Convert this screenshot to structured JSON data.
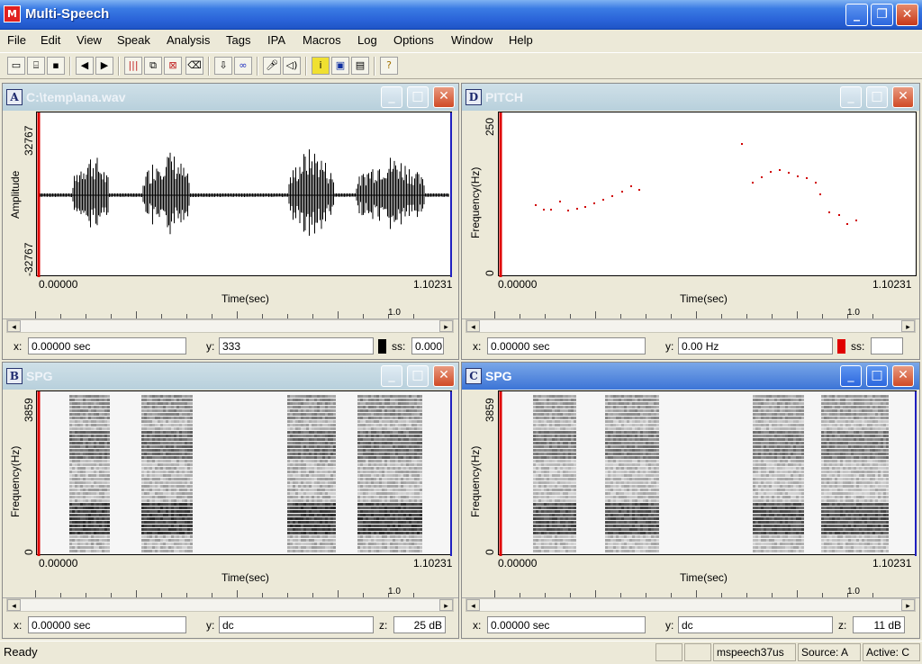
{
  "app": {
    "title": "Multi-Speech",
    "icon": "multi-speech-logo",
    "ready": "Ready"
  },
  "menu": [
    "File",
    "Edit",
    "View",
    "Speak",
    "Analysis",
    "Tags",
    "IPA",
    "Macros",
    "Log",
    "Options",
    "Window",
    "Help"
  ],
  "toolbar_icons": [
    "new-icon",
    "open-icon",
    "save-icon",
    "back-icon",
    "forward-icon",
    "bars-icon",
    "copy-window-icon",
    "delete-window-icon",
    "eraser-icon",
    "down-arrow-icon",
    "link-icon",
    "microphone-icon",
    "speaker-icon",
    "info-icon",
    "window-icon",
    "grid-icon",
    "help-icon"
  ],
  "panes": [
    {
      "letter": "A",
      "title": "C:\\temp\\ana.wav",
      "ylabel": "Amplitude",
      "ytop": "32767",
      "ybot": "-32767",
      "xstart": "0.00000",
      "xend": "1.10231",
      "xlabel": "Time(sec)",
      "ruler_mark": "1.0",
      "status": {
        "xlabel": "x:",
        "xval": "0.00000 sec",
        "ylabel": "y:",
        "yval": "333",
        "tag": "ss:",
        "tagval": "0.000"
      }
    },
    {
      "letter": "D",
      "title": "PITCH",
      "ylabel": "Frequency(Hz)",
      "ytop": "250",
      "ybot": "0",
      "xstart": "0.00000",
      "xend": "1.10231",
      "xlabel": "Time(sec)",
      "ruler_mark": "1.0",
      "status": {
        "xlabel": "x:",
        "xval": "0.00000 sec",
        "ylabel": "y:",
        "yval": "0.00 Hz",
        "tag": "ss:",
        "tagval": ""
      }
    },
    {
      "letter": "B",
      "title": "SPG",
      "ylabel": "Frequency(Hz)",
      "ytop": "3859",
      "ybot": "0",
      "xstart": "0.00000",
      "xend": "1.10231",
      "xlabel": "Time(sec)",
      "ruler_mark": "1.0",
      "status": {
        "xlabel": "x:",
        "xval": "0.00000 sec",
        "ylabel": "y:",
        "yval": "dc",
        "tag": "z:",
        "tagval": "25 dB"
      }
    },
    {
      "letter": "C",
      "title": "SPG",
      "ylabel": "Frequency(Hz)",
      "ytop": "3859",
      "ybot": "0",
      "xstart": "0.00000",
      "xend": "1.10231",
      "xlabel": "Time(sec)",
      "ruler_mark": "1.0",
      "status": {
        "xlabel": "x:",
        "xval": "0.00000 sec",
        "ylabel": "y:",
        "yval": "dc",
        "tag": "z:",
        "tagval": "11 dB"
      }
    }
  ],
  "statusbar": {
    "file": "mspeech37us",
    "source": "Source: A",
    "active": "Active: C"
  },
  "colors": {
    "cursor": "#e00000",
    "end_marker": "#2020c0",
    "pitch_points": "#d00000"
  }
}
